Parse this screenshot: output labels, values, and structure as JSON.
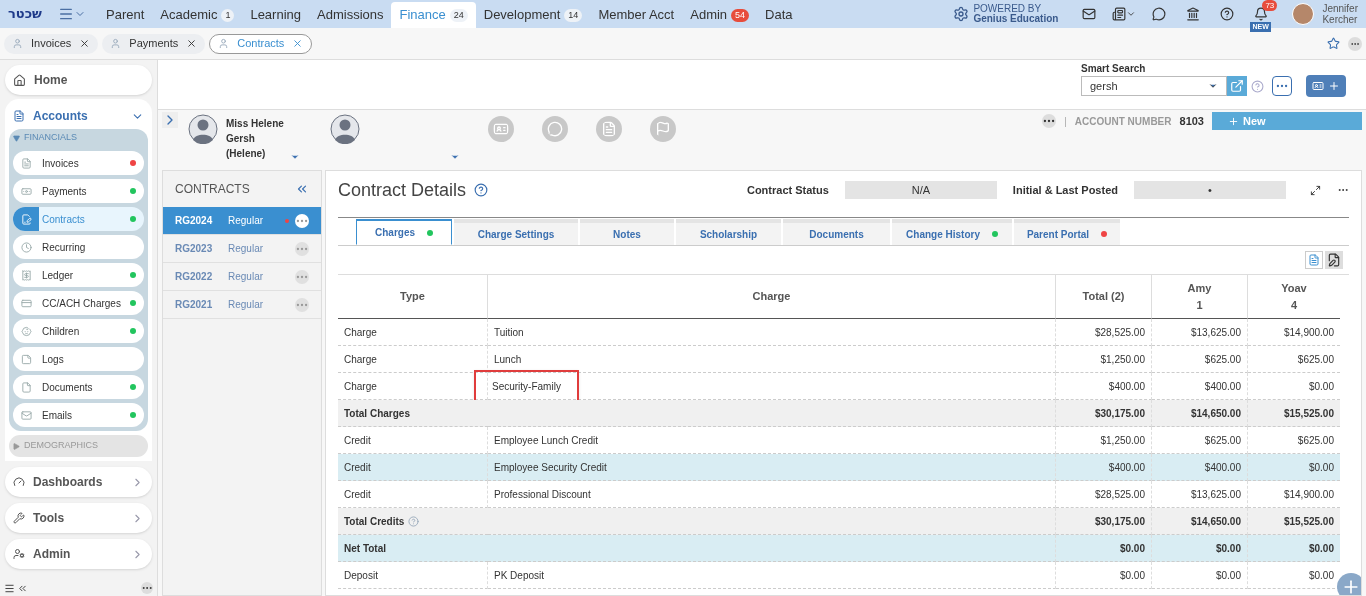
{
  "topnav": {
    "logo": "שכטר",
    "items": [
      {
        "label": "Parent",
        "selected": false
      },
      {
        "label": "Academic",
        "selected": false,
        "badge": "1",
        "alert": false
      },
      {
        "label": "Learning",
        "selected": false
      },
      {
        "label": "Admissions",
        "selected": false
      },
      {
        "label": "Finance",
        "selected": true,
        "badge": "24",
        "alert": false
      },
      {
        "label": "Development",
        "selected": false,
        "badge": "14",
        "alert": false
      },
      {
        "label": "Member Acct",
        "selected": false
      },
      {
        "label": "Admin",
        "selected": false,
        "badge": "54",
        "alert": true
      },
      {
        "label": "Data",
        "selected": false
      }
    ],
    "powered_by": "POWERED BY",
    "powered_name": "Genius Education",
    "notifications": "73",
    "new_label": "NEW",
    "user_first": "Jennifer",
    "user_last": "Kercher"
  },
  "open_tabs": [
    {
      "label": "Invoices",
      "selected": false
    },
    {
      "label": "Payments",
      "selected": false
    },
    {
      "label": "Contracts",
      "selected": true
    }
  ],
  "sidebar": {
    "home": "Home",
    "accounts": "Accounts",
    "financials": "FINANCIALS",
    "items": [
      {
        "label": "Invoices",
        "selected": false,
        "color": "#ef4444"
      },
      {
        "label": "Payments",
        "selected": false,
        "color": "#22c55e"
      },
      {
        "label": "Contracts",
        "selected": true,
        "color": "#22c55e"
      },
      {
        "label": "Recurring",
        "selected": false
      },
      {
        "label": "Ledger",
        "selected": false,
        "color": "#22c55e"
      },
      {
        "label": "CC/ACH Charges",
        "selected": false,
        "color": "#22c55e"
      },
      {
        "label": "Children",
        "selected": false,
        "color": "#22c55e"
      },
      {
        "label": "Logs",
        "selected": false
      },
      {
        "label": "Documents",
        "selected": false,
        "color": "#22c55e"
      },
      {
        "label": "Emails",
        "selected": false,
        "color": "#22c55e"
      }
    ],
    "demographics": "DEMOGRAPHICS",
    "sections": [
      "Dashboards",
      "Tools",
      "Admin"
    ]
  },
  "smart_search": {
    "label": "Smart Search",
    "value": "gersh"
  },
  "profile": {
    "separator": "|",
    "name_lines": [
      "Miss Helene",
      "Gersh",
      "(Helene)"
    ],
    "account_label": "ACCOUNT NUMBER",
    "account_number": "8103",
    "new_button": "New"
  },
  "contracts": {
    "title": "CONTRACTS",
    "items": [
      {
        "code": "RG2024",
        "type": "Regular",
        "selected": true,
        "flag": true
      },
      {
        "code": "RG2023",
        "type": "Regular",
        "selected": false,
        "flag": false
      },
      {
        "code": "RG2022",
        "type": "Regular",
        "selected": false,
        "flag": false
      },
      {
        "code": "RG2021",
        "type": "Regular",
        "selected": false,
        "flag": false
      }
    ]
  },
  "details": {
    "title": "Contract Details",
    "status_label": "Contract Status",
    "status_value": "N/A",
    "posted_label": "Initial & Last Posted",
    "posted_value": "•",
    "tabs": [
      {
        "label": "Charges",
        "selected": true,
        "color": "#22c55e"
      },
      {
        "label": "Charge Settings",
        "selected": false
      },
      {
        "label": "Notes",
        "selected": false
      },
      {
        "label": "Scholarship",
        "selected": false
      },
      {
        "label": "Documents",
        "selected": false
      },
      {
        "label": "Change History",
        "selected": false,
        "color": "#22c55e"
      },
      {
        "label": "Parent Portal",
        "selected": false,
        "color": "#ef4444"
      }
    ],
    "table": {
      "columns": [
        {
          "name": "Type"
        },
        {
          "name": "Charge"
        },
        {
          "name": "Total (2)"
        },
        {
          "name": "Amy",
          "count": "1"
        },
        {
          "name": "Yoav",
          "count": "4"
        }
      ],
      "rows": [
        {
          "kind": "line",
          "cells": [
            "Charge",
            "Tuition",
            "$28,525.00",
            "$13,625.00",
            "$14,900.00"
          ],
          "selected": false,
          "outlined": false
        },
        {
          "kind": "line",
          "cells": [
            "Charge",
            "Lunch",
            "$1,250.00",
            "$625.00",
            "$625.00"
          ],
          "selected": false,
          "outlined": false
        },
        {
          "kind": "line",
          "cells": [
            "Charge",
            "Security-Family",
            "$400.00",
            "$400.00",
            "$0.00"
          ],
          "selected": false,
          "outlined": true
        },
        {
          "kind": "total",
          "cells": [
            "Total Charges",
            "",
            "$30,175.00",
            "$14,650.00",
            "$15,525.00"
          ],
          "help": false
        },
        {
          "kind": "line",
          "cells": [
            "Credit",
            "Employee Lunch Credit",
            "$1,250.00",
            "$625.00",
            "$625.00"
          ],
          "selected": false,
          "outlined": false
        },
        {
          "kind": "line",
          "cells": [
            "Credit",
            "Employee Security Credit",
            "$400.00",
            "$400.00",
            "$0.00"
          ],
          "selected": true,
          "outlined": false
        },
        {
          "kind": "line",
          "cells": [
            "Credit",
            "Professional Discount",
            "$28,525.00",
            "$13,625.00",
            "$14,900.00"
          ],
          "selected": false,
          "outlined": false
        },
        {
          "kind": "total",
          "cells": [
            "Total Credits",
            "",
            "$30,175.00",
            "$14,650.00",
            "$15,525.00"
          ],
          "help": true
        },
        {
          "kind": "net",
          "cells": [
            "Net Total",
            "",
            "$0.00",
            "$0.00",
            "$0.00"
          ]
        },
        {
          "kind": "line",
          "cells": [
            "Deposit",
            "PK Deposit",
            "$0.00",
            "$0.00",
            "$0.00"
          ],
          "selected": false,
          "outlined": false
        }
      ]
    }
  }
}
